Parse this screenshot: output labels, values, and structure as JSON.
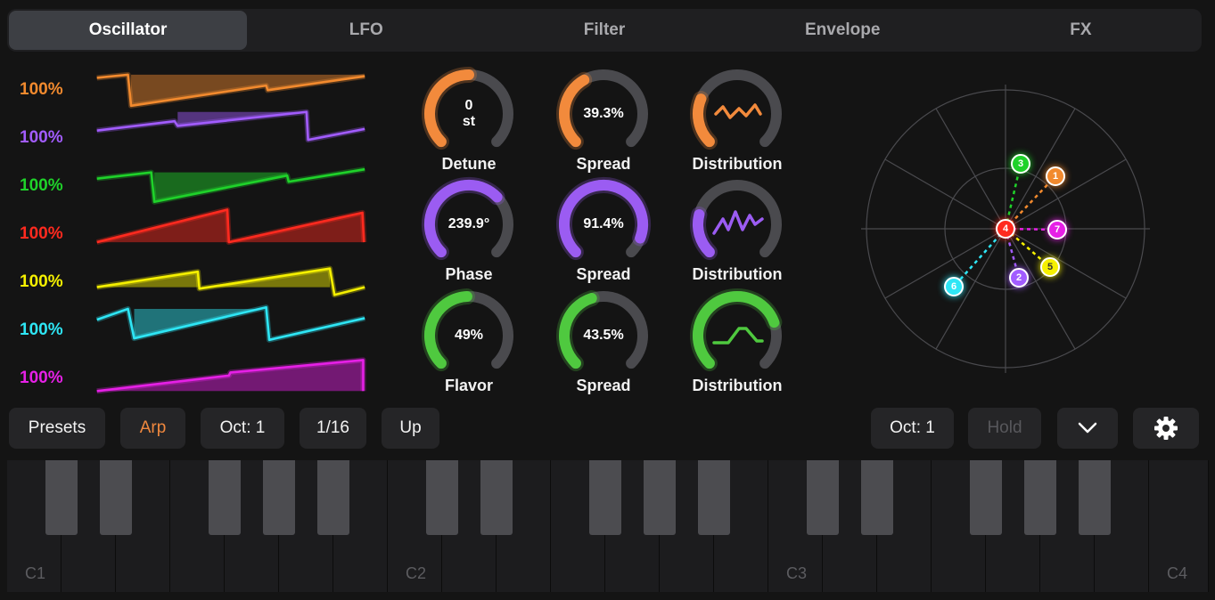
{
  "tabs": [
    {
      "label": "Oscillator",
      "active": true
    },
    {
      "label": "LFO",
      "active": false
    },
    {
      "label": "Filter",
      "active": false
    },
    {
      "label": "Envelope",
      "active": false
    },
    {
      "label": "FX",
      "active": false
    }
  ],
  "voices": [
    {
      "percent": "100%",
      "color": "#f28a2e"
    },
    {
      "percent": "100%",
      "color": "#a25cff"
    },
    {
      "percent": "100%",
      "color": "#1fd22a"
    },
    {
      "percent": "100%",
      "color": "#ff2a1f"
    },
    {
      "percent": "100%",
      "color": "#f5f000"
    },
    {
      "percent": "100%",
      "color": "#2ee6f5"
    },
    {
      "percent": "100%",
      "color": "#e620e6"
    }
  ],
  "knobs": [
    {
      "value_line1": "0",
      "value_line2": "st",
      "label": "Detune",
      "fraction": 0.5,
      "color": "#f28a3c"
    },
    {
      "value_line1": "39.3%",
      "value_line2": "",
      "label": "Spread",
      "fraction": 0.39,
      "color": "#f28a3c"
    },
    {
      "value_line1": "",
      "value_line2": "",
      "label": "Distribution",
      "fraction": 0.25,
      "color": "#f28a3c",
      "icon": "distribution-jagged-icon"
    },
    {
      "value_line1": "239.9°",
      "value_line2": "",
      "label": "Phase",
      "fraction": 0.67,
      "color": "#9b5cf2"
    },
    {
      "value_line1": "91.4%",
      "value_line2": "",
      "label": "Spread",
      "fraction": 0.91,
      "color": "#9b5cf2"
    },
    {
      "value_line1": "",
      "value_line2": "",
      "label": "Distribution",
      "fraction": 0.22,
      "color": "#9b5cf2",
      "icon": "distribution-zigzag-icon"
    },
    {
      "value_line1": "49%",
      "value_line2": "",
      "label": "Flavor",
      "fraction": 0.49,
      "color": "#4fc93f"
    },
    {
      "value_line1": "43.5%",
      "value_line2": "",
      "label": "Spread",
      "fraction": 0.435,
      "color": "#4fc93f"
    },
    {
      "value_line1": "",
      "value_line2": "",
      "label": "Distribution",
      "fraction": 0.76,
      "color": "#4fc93f",
      "icon": "distribution-bump-icon"
    }
  ],
  "polar_nodes": [
    {
      "label": "1",
      "color": "#f28a2e"
    },
    {
      "label": "2",
      "color": "#a25cff"
    },
    {
      "label": "3",
      "color": "#1fd22a"
    },
    {
      "label": "4",
      "color": "#ff2a1f"
    },
    {
      "label": "5",
      "color": "#f5f000"
    },
    {
      "label": "6",
      "color": "#2ee6f5"
    },
    {
      "label": "7",
      "color": "#e620e6"
    }
  ],
  "controls": {
    "presets_label": "Presets",
    "arp_label": "Arp",
    "oct_label": "Oct: 1",
    "rate_label": "1/16",
    "direction_label": "Up",
    "keyboard_oct_label": "Oct: 1",
    "hold_label": "Hold",
    "collapse_icon": "chevron-down-icon",
    "settings_icon": "gear-icon"
  },
  "keyboard": {
    "octave_labels": [
      "C1",
      "C2",
      "C3",
      "C4"
    ]
  }
}
